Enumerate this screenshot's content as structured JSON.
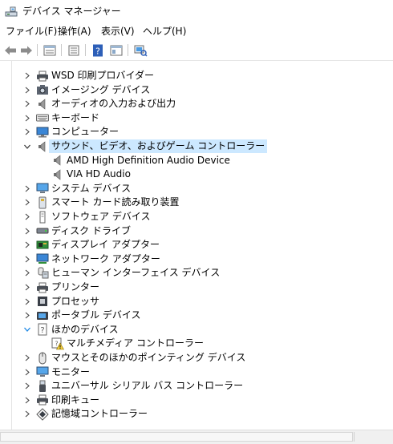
{
  "window": {
    "title": "デバイス マネージャー",
    "icon": "device-manager-icon"
  },
  "menu": [
    {
      "label": "ファイル(F)"
    },
    {
      "label": "操作(A)"
    },
    {
      "label": "表示(V)"
    },
    {
      "label": "ヘルプ(H)"
    }
  ],
  "toolbar": [
    {
      "icon": "back-arrow-icon"
    },
    {
      "icon": "forward-arrow-icon"
    },
    {
      "icon": "properties-icon"
    },
    {
      "icon": "device-list-icon"
    },
    {
      "icon": "help-icon"
    },
    {
      "icon": "properties-pane-icon"
    },
    {
      "icon": "scan-hardware-icon"
    }
  ],
  "tree": [
    {
      "label": "WSD 印刷プロバイダー",
      "icon": "printer-icon",
      "level": 0,
      "expander": "collapsed"
    },
    {
      "label": "イメージング デバイス",
      "icon": "camera-icon",
      "level": 0,
      "expander": "collapsed"
    },
    {
      "label": "オーディオの入力および出力",
      "icon": "speaker-icon",
      "level": 0,
      "expander": "collapsed"
    },
    {
      "label": "キーボード",
      "icon": "keyboard-icon",
      "level": 0,
      "expander": "collapsed"
    },
    {
      "label": "コンピューター",
      "icon": "computer-icon",
      "level": 0,
      "expander": "collapsed"
    },
    {
      "label": "サウンド、ビデオ、およびゲーム コントローラー",
      "icon": "speaker-icon",
      "level": 0,
      "expander": "expanded",
      "selected": true
    },
    {
      "label": "AMD High Definition Audio Device",
      "icon": "speaker-icon",
      "level": 1,
      "expander": "none"
    },
    {
      "label": "VIA HD Audio",
      "icon": "speaker-icon",
      "level": 1,
      "expander": "none"
    },
    {
      "label": "システム デバイス",
      "icon": "monitor-icon",
      "level": 0,
      "expander": "collapsed"
    },
    {
      "label": "スマート カード読み取り装置",
      "icon": "smartcard-reader-icon",
      "level": 0,
      "expander": "collapsed"
    },
    {
      "label": "ソフトウェア デバイス",
      "icon": "software-device-icon",
      "level": 0,
      "expander": "collapsed"
    },
    {
      "label": "ディスク ドライブ",
      "icon": "disk-drive-icon",
      "level": 0,
      "expander": "collapsed"
    },
    {
      "label": "ディスプレイ アダプター",
      "icon": "display-adapter-icon",
      "level": 0,
      "expander": "collapsed"
    },
    {
      "label": "ネットワーク アダプター",
      "icon": "network-adapter-icon",
      "level": 0,
      "expander": "collapsed"
    },
    {
      "label": "ヒューマン インターフェイス デバイス",
      "icon": "hid-icon",
      "level": 0,
      "expander": "collapsed"
    },
    {
      "label": "プリンター",
      "icon": "printer-icon",
      "level": 0,
      "expander": "collapsed"
    },
    {
      "label": "プロセッサ",
      "icon": "processor-icon",
      "level": 0,
      "expander": "collapsed"
    },
    {
      "label": "ポータブル デバイス",
      "icon": "portable-device-icon",
      "level": 0,
      "expander": "collapsed"
    },
    {
      "label": "ほかのデバイス",
      "icon": "unknown-device-icon",
      "level": 0,
      "expander": "expanded-blue"
    },
    {
      "label": "マルチメディア コントローラー",
      "icon": "warning-device-icon",
      "level": 1,
      "expander": "none"
    },
    {
      "label": "マウスとそのほかのポインティング デバイス",
      "icon": "mouse-icon",
      "level": 0,
      "expander": "collapsed"
    },
    {
      "label": "モニター",
      "icon": "monitor-icon",
      "level": 0,
      "expander": "collapsed"
    },
    {
      "label": "ユニバーサル シリアル バス コントローラー",
      "icon": "usb-icon",
      "level": 0,
      "expander": "collapsed"
    },
    {
      "label": "印刷キュー",
      "icon": "printer-icon",
      "level": 0,
      "expander": "collapsed"
    },
    {
      "label": "記憶域コントローラー",
      "icon": "storage-controller-icon",
      "level": 0,
      "expander": "collapsed"
    }
  ]
}
